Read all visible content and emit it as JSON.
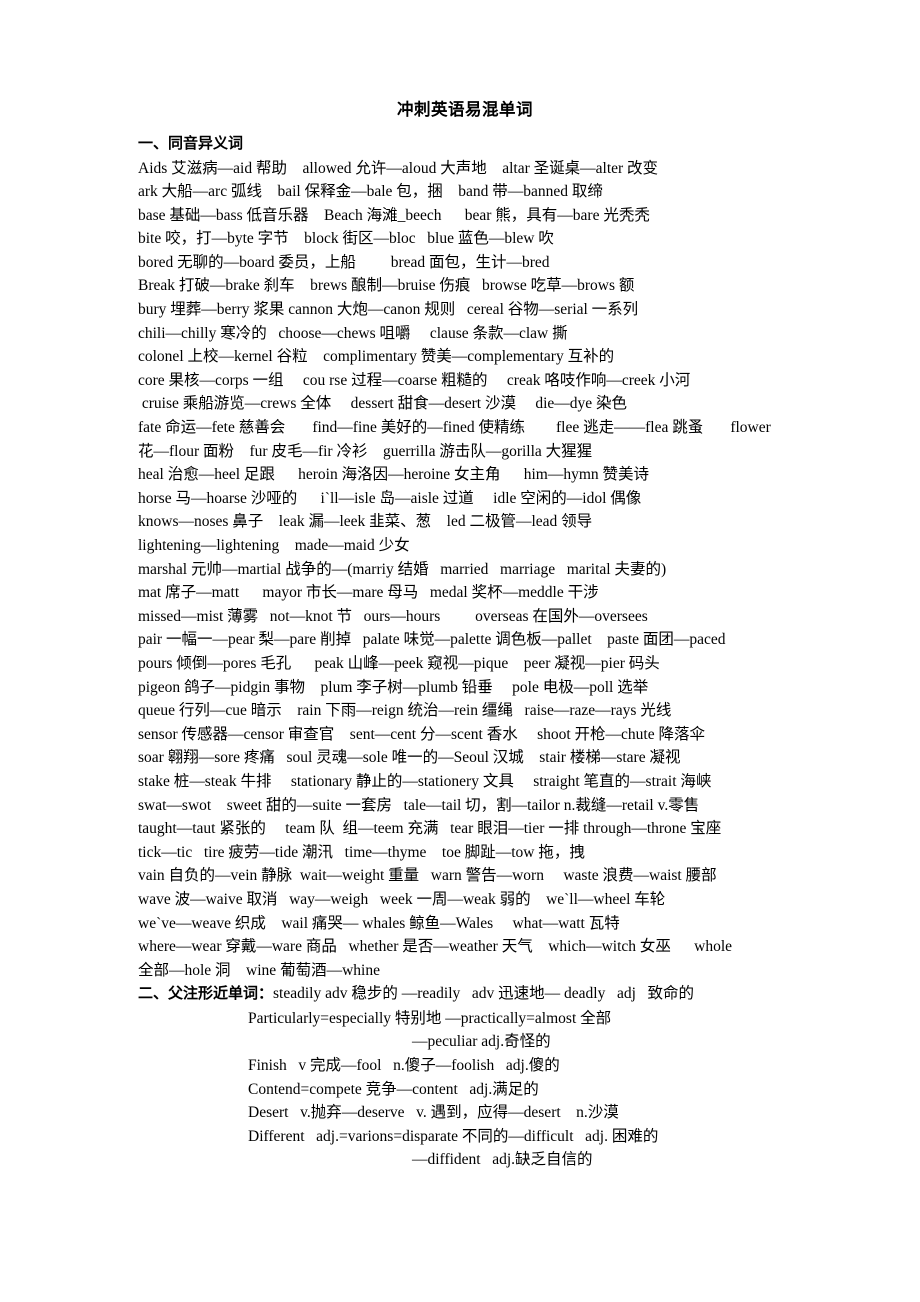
{
  "document": {
    "title": "冲刺英语易混单词",
    "sections": [
      {
        "heading": "一、同音异义词",
        "heading_tail": "",
        "lines": [
          {
            "text": "Aids 艾滋病—aid 帮助    allowed 允许—aloud 大声地    altar 圣诞桌—alter 改变",
            "indent": "none"
          },
          {
            "text": "ark 大船—arc 弧线    bail 保释金—bale 包，捆    band 带—banned 取缔",
            "indent": "none"
          },
          {
            "text": "base 基础—bass 低音乐器    Beach 海滩_beech      bear 熊，具有—bare 光秃秃",
            "indent": "none"
          },
          {
            "text": "bite 咬，打—byte 字节    block 街区—bloc   blue 蓝色—blew 吹",
            "indent": "none"
          },
          {
            "text": "bored 无聊的—board 委员，上船         bread 面包，生计—bred",
            "indent": "none"
          },
          {
            "text": "Break 打破—brake 刹车    brews 酿制—bruise 伤痕   browse 吃草—brows 额",
            "indent": "none"
          },
          {
            "text": "bury 埋葬—berry 浆果 cannon 大炮—canon 规则   cereal 谷物—serial 一系列",
            "indent": "none"
          },
          {
            "text": "chili—chilly 寒冷的   choose—chews 咀嚼     clause 条款—claw 撕",
            "indent": "none"
          },
          {
            "text": "colonel 上校—kernel 谷粒    complimentary 赞美—complementary 互补的",
            "indent": "none"
          },
          {
            "text": "core 果核—corps 一组     cou rse 过程—coarse 粗糙的     creak 咯吱作响—creek 小河",
            "indent": "none"
          },
          {
            "text": " cruise 乘船游览—crews 全体     dessert 甜食—desert 沙漠     die—dye 染色",
            "indent": "none"
          },
          {
            "text": "fate 命运—fete 慈善会       find—fine 美好的—fined 使精练        flee 逃走——flea 跳蚤       flower",
            "indent": "none"
          },
          {
            "text": "花—flour 面粉    fur 皮毛—fir 冷衫    guerrilla 游击队—gorilla 大猩猩",
            "indent": "none"
          },
          {
            "text": "heal 治愈—heel 足跟      heroin 海洛因—heroine 女主角      him—hymn 赞美诗",
            "indent": "none"
          },
          {
            "text": "horse 马—hoarse 沙哑的      i`ll—isle 岛—aisle 过道     idle 空闲的—idol 偶像",
            "indent": "none"
          },
          {
            "text": "knows—noses 鼻子    leak 漏—leek 韭菜、葱    led 二极管—lead 领导",
            "indent": "none"
          },
          {
            "text": "lightening—lightening    made—maid 少女",
            "indent": "none"
          },
          {
            "text": "marshal 元帅—martial 战争的—(marriy 结婚   married   marriage   marital 夫妻的)",
            "indent": "none"
          },
          {
            "text": "mat 席子—matt      mayor 市长—mare 母马   medal 奖杯—meddle 干涉",
            "indent": "none"
          },
          {
            "text": "missed—mist 薄雾   not—knot 节   ours—hours         overseas 在国外—oversees",
            "indent": "none"
          },
          {
            "text": "pair 一幅一—pear 梨—pare 削掉   palate 味觉—palette 调色板—pallet    paste 面团—paced",
            "indent": "none"
          },
          {
            "text": "pours 倾倒—pores 毛孔      peak 山峰—peek 窥视—pique    peer 凝视—pier 码头",
            "indent": "none"
          },
          {
            "text": "pigeon 鸽子—pidgin 事物    plum 李子树—plumb 铅垂     pole 电极—poll 选举",
            "indent": "none"
          },
          {
            "text": "queue 行列—cue 暗示    rain 下雨—reign 统治—rein 缰绳   raise—raze—rays 光线",
            "indent": "none"
          },
          {
            "text": "sensor 传感器—censor 审查官    sent—cent 分—scent 香水     shoot 开枪—chute 降落伞",
            "indent": "none"
          },
          {
            "text": "soar 翱翔—sore 疼痛   soul 灵魂—sole 唯一的—Seoul 汉城    stair 楼梯—stare 凝视",
            "indent": "none"
          },
          {
            "text": "stake 桩—steak 牛排     stationary 静止的—stationery 文具     straight 笔直的—strait 海峡",
            "indent": "none"
          },
          {
            "text": "swat—swot    sweet 甜的—suite 一套房   tale—tail 切，割—tailor n.裁缝—retail v.零售",
            "indent": "none"
          },
          {
            "text": "taught—taut 紧张的     team 队  组—teem 充满   tear 眼泪—tier 一排 through—throne 宝座",
            "indent": "none"
          },
          {
            "text": "tick—tic   tire 疲劳—tide 潮汛   time—thyme    toe 脚趾—tow 拖，拽",
            "indent": "none"
          },
          {
            "text": "vain 自负的—vein 静脉  wait—weight 重量   warn 警告—worn     waste 浪费—waist 腰部",
            "indent": "none"
          },
          {
            "text": "wave 波—waive 取消   way—weigh   week 一周—weak 弱的    we`ll—wheel 车轮",
            "indent": "none"
          },
          {
            "text": "we`ve—weave 织成    wail 痛哭— whales 鲸鱼—Wales     what—watt 瓦特",
            "indent": "none"
          },
          {
            "text": "where—wear 穿戴—ware 商品   whether 是否—weather 天气    which—witch 女巫      whole",
            "indent": "none"
          },
          {
            "text": "全部—hole 洞    wine 葡萄酒—whine",
            "indent": "none"
          }
        ]
      },
      {
        "heading": "二、父注形近单词：",
        "heading_tail": "steadily adv 稳步的 —readily   adv 迅速地— deadly   adj   致命的",
        "lines": [
          {
            "text": "Particularly=especially 特别地 —practically=almost 全部",
            "indent": "deep"
          },
          {
            "text": "—peculiar adj.奇怪的",
            "indent": "deeper"
          },
          {
            "text": "Finish   v 完成—fool   n.傻子—foolish   adj.傻的",
            "indent": "deep"
          },
          {
            "text": "Contend=compete 竞争—content   adj.满足的",
            "indent": "deep"
          },
          {
            "text": "Desert   v.抛弃—deserve   v. 遇到，应得—desert    n.沙漠",
            "indent": "deep"
          },
          {
            "text": "Different   adj.=varions=disparate 不同的—difficult   adj. 困难的",
            "indent": "deep"
          },
          {
            "text": "—diffident   adj.缺乏自信的",
            "indent": "deeper"
          }
        ]
      }
    ]
  }
}
